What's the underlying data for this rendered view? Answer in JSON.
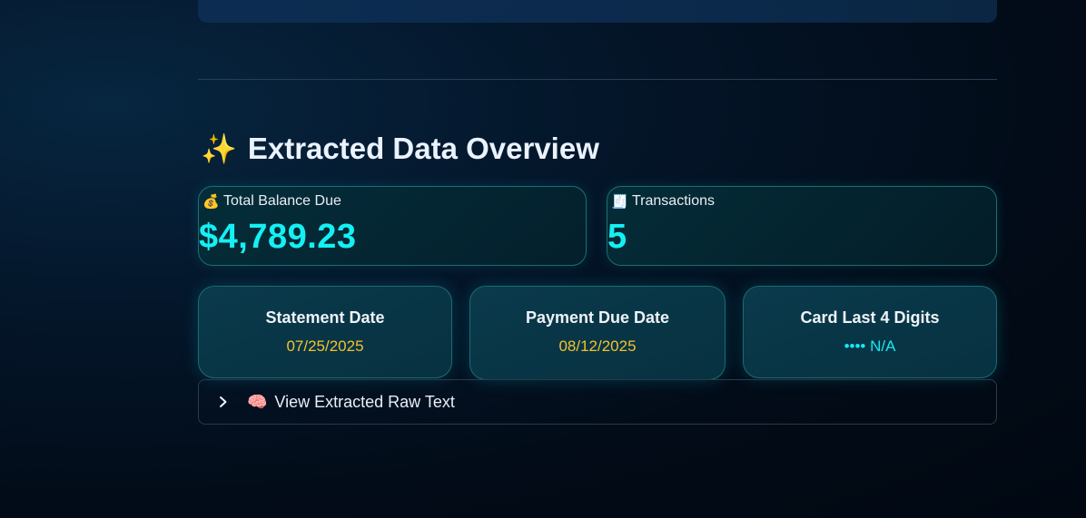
{
  "section": {
    "icon": "sparkles-icon",
    "title": "Extracted Data Overview"
  },
  "metrics": [
    {
      "icon": "money-bag-icon",
      "label": "Total Balance Due",
      "value": "$4,789.23"
    },
    {
      "icon": "receipt-icon",
      "label": "Transactions",
      "value": "5"
    }
  ],
  "info_cards": [
    {
      "title": "Statement Date",
      "value": "07/25/2025"
    },
    {
      "title": "Payment Due Date",
      "value": "08/12/2025"
    },
    {
      "title": "Card Last 4 Digits",
      "value": "•••• N/A"
    }
  ],
  "expander": {
    "icon": "brain-icon",
    "label": "View Extracted Raw Text",
    "expanded": false
  },
  "colors": {
    "accent_cyan": "#14f0f4",
    "date_gold": "#f2c230",
    "background": "#020b17"
  }
}
